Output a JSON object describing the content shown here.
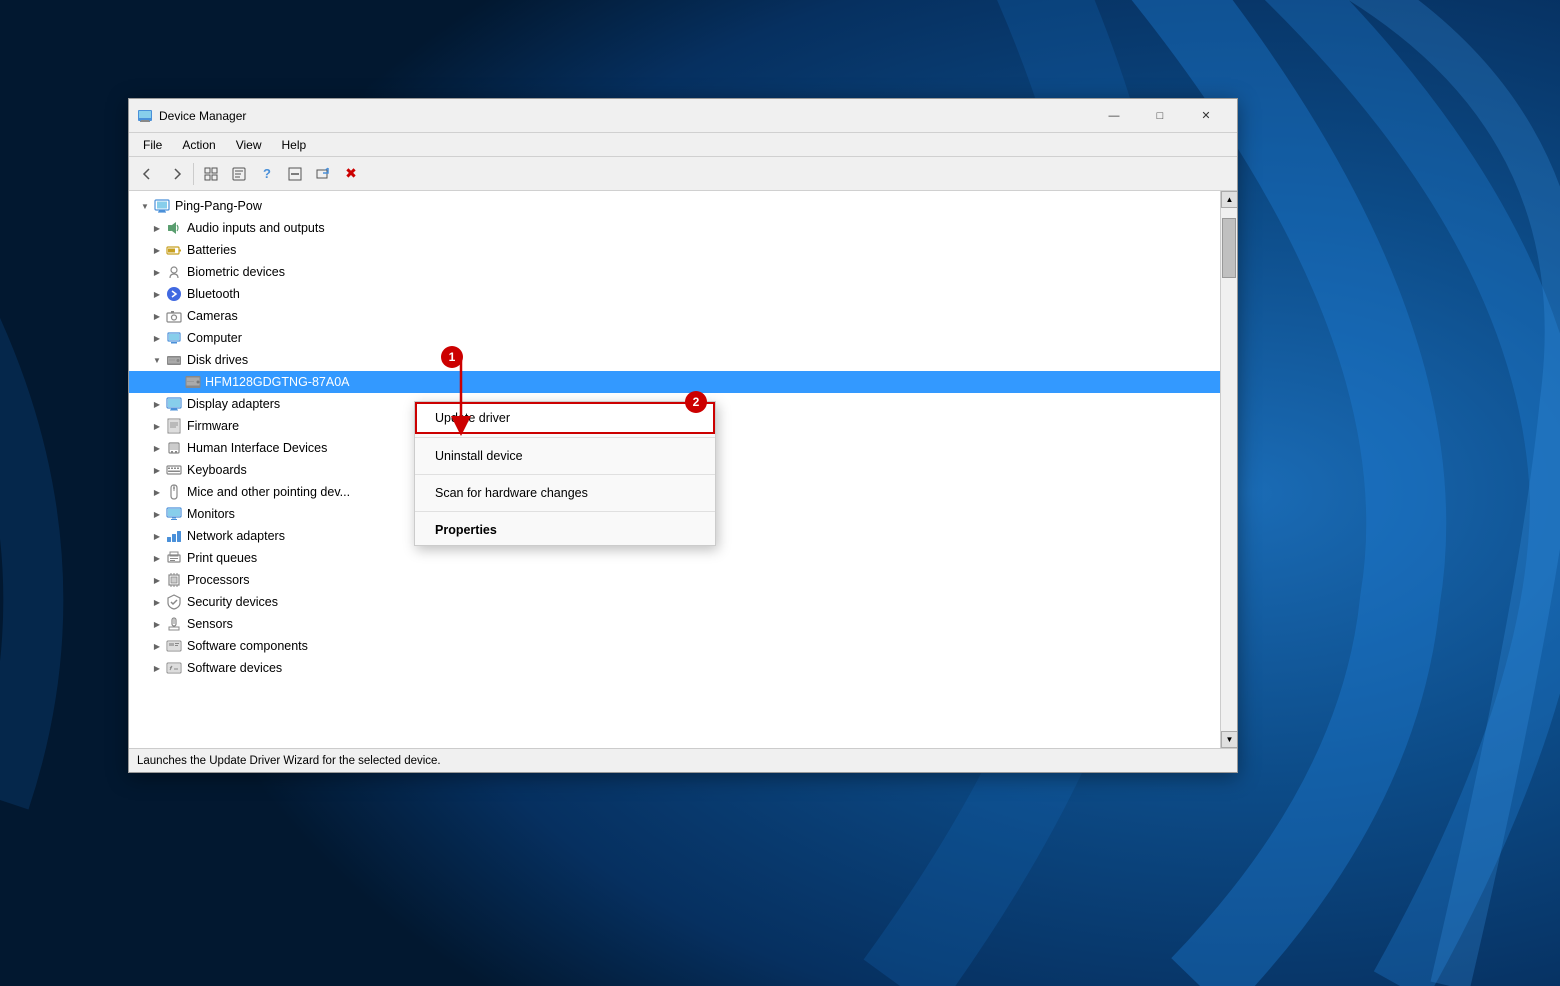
{
  "background": {
    "color": "#0a3d6e"
  },
  "window": {
    "title": "Device Manager",
    "min_label": "minimize",
    "max_label": "maximize",
    "close_label": "close"
  },
  "menu": {
    "items": [
      "File",
      "Action",
      "View",
      "Help"
    ]
  },
  "toolbar": {
    "buttons": [
      "◀",
      "▶",
      "⊞",
      "☐",
      "?",
      "⊟",
      "⊕",
      "✖"
    ]
  },
  "tree": {
    "root": {
      "label": "Ping-Pang-Pow",
      "expanded": true
    },
    "items": [
      {
        "label": "Audio inputs and outputs",
        "icon": "audio",
        "indent": 1,
        "expanded": false
      },
      {
        "label": "Batteries",
        "icon": "battery",
        "indent": 1,
        "expanded": false
      },
      {
        "label": "Biometric devices",
        "icon": "biometric",
        "indent": 1,
        "expanded": false
      },
      {
        "label": "Bluetooth",
        "icon": "bluetooth",
        "indent": 1,
        "expanded": false
      },
      {
        "label": "Cameras",
        "icon": "camera",
        "indent": 1,
        "expanded": false
      },
      {
        "label": "Computer",
        "icon": "comp",
        "indent": 1,
        "expanded": false
      },
      {
        "label": "Disk drives",
        "icon": "disk",
        "indent": 1,
        "expanded": true
      },
      {
        "label": "HFM128GDGTNG-87A0A",
        "icon": "disk-item",
        "indent": 2,
        "expanded": false,
        "selected": true
      },
      {
        "label": "Display adapters",
        "icon": "display",
        "indent": 1,
        "expanded": false
      },
      {
        "label": "Firmware",
        "icon": "firmware",
        "indent": 1,
        "expanded": false
      },
      {
        "label": "Human Interface Devices",
        "icon": "hid",
        "indent": 1,
        "expanded": false
      },
      {
        "label": "Keyboards",
        "icon": "keyboard",
        "indent": 1,
        "expanded": false
      },
      {
        "label": "Mice and other pointing dev...",
        "icon": "mouse",
        "indent": 1,
        "expanded": false
      },
      {
        "label": "Monitors",
        "icon": "monitor",
        "indent": 1,
        "expanded": false
      },
      {
        "label": "Network adapters",
        "icon": "network",
        "indent": 1,
        "expanded": false
      },
      {
        "label": "Print queues",
        "icon": "print",
        "indent": 1,
        "expanded": false
      },
      {
        "label": "Processors",
        "icon": "processor",
        "indent": 1,
        "expanded": false
      },
      {
        "label": "Security devices",
        "icon": "security",
        "indent": 1,
        "expanded": false
      },
      {
        "label": "Sensors",
        "icon": "sensor",
        "indent": 1,
        "expanded": false
      },
      {
        "label": "Software components",
        "icon": "software-comp",
        "indent": 1,
        "expanded": false
      },
      {
        "label": "Software devices",
        "icon": "software-dev",
        "indent": 1,
        "expanded": false
      }
    ]
  },
  "context_menu": {
    "items": [
      {
        "label": "Update driver",
        "bold": false,
        "highlighted": true
      },
      {
        "label": "Uninstall device",
        "bold": false
      },
      {
        "label": "Scan for hardware changes",
        "bold": false
      },
      {
        "label": "Properties",
        "bold": true
      }
    ]
  },
  "annotations": {
    "circle1": "1",
    "circle2": "2"
  },
  "status_bar": {
    "text": "Launches the Update Driver Wizard for the selected device."
  }
}
